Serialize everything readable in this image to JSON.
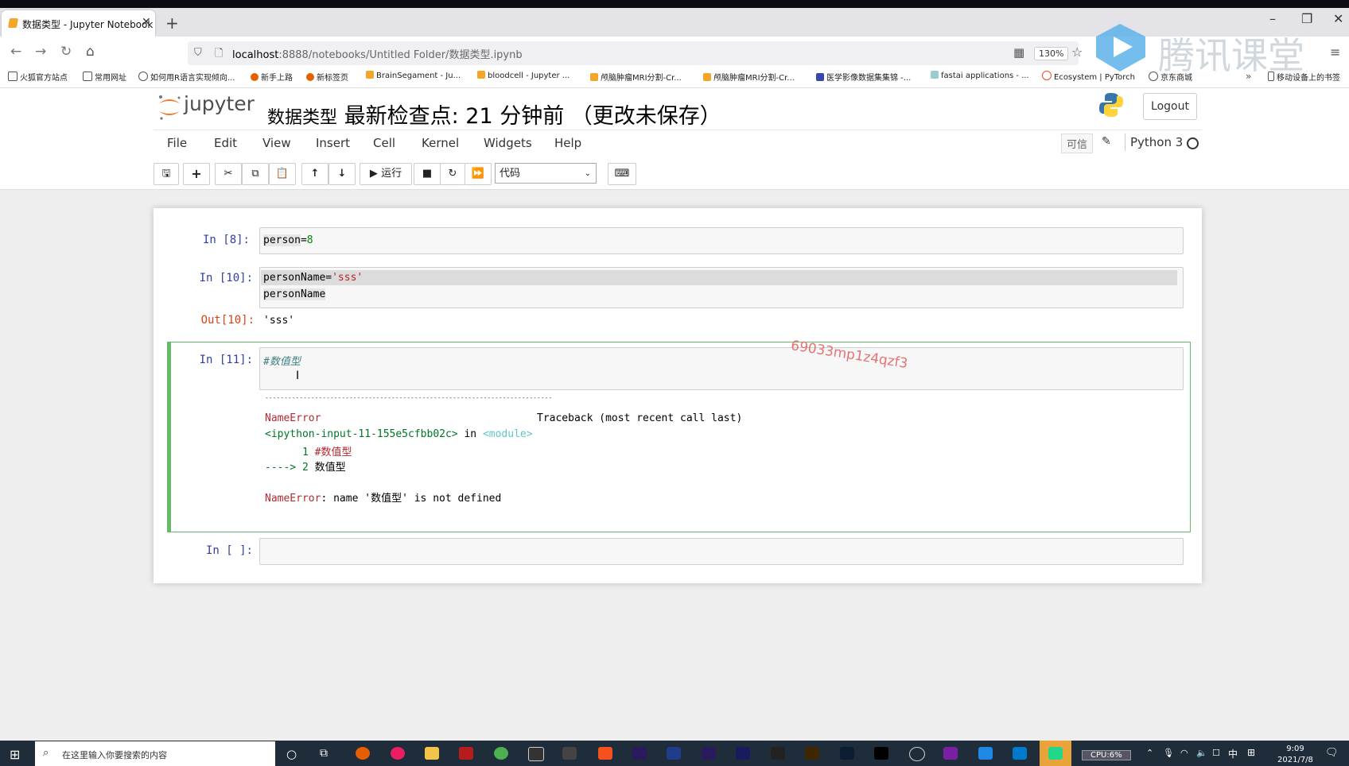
{
  "browser": {
    "tab_title": "数据类型 - Jupyter Notebook",
    "url_host": "localhost",
    "url_rest": ":8888/notebooks/Untitled Folder/数据类型.ipynb",
    "zoom": "130%",
    "bookmarks": [
      "火狐官方站点",
      "常用网址",
      "如何用R语言实现倾向...",
      "新手上路",
      "新标签页",
      "BrainSegament - Ju...",
      "bloodcell - Jupyter ...",
      "颅脑肿瘤MRI分割-Cr...",
      "颅脑肿瘤MRI分割-Cr...",
      "医学影像数据集集锦 -...",
      "fastai applications - ...",
      "Ecosystem | PyTorch",
      "京东商城"
    ],
    "mobile_bookmarks": "移动设备上的书签"
  },
  "overlay": {
    "brand": "腾讯课堂",
    "watermark": "69033mp1z4qzf3"
  },
  "jupyter": {
    "logo_text": "jupyter",
    "notebook_name": "数据类型",
    "checkpoint": "最新检查点: 21 分钟前 （更改未保存）",
    "logout": "Logout",
    "menu": [
      "File",
      "Edit",
      "View",
      "Insert",
      "Cell",
      "Kernel",
      "Widgets",
      "Help"
    ],
    "trusted": "可信",
    "kernel": "Python 3",
    "run_label": "运行",
    "cell_type": "代码"
  },
  "cells": {
    "c1_prompt": "In  [8]:",
    "c1_code_a": "person",
    "c1_code_b": "=",
    "c1_code_c": "8",
    "c2_prompt": "In  [10]:",
    "c2_line1_a": "personName",
    "c2_line1_b": "=",
    "c2_line1_c": "'sss'",
    "c2_line2": "personName",
    "c2_out_prompt": "Out[10]:",
    "c2_out": "'sss'",
    "c3_prompt": "In  [11]:",
    "c3_code": "#数值型",
    "err_rule": "---------------------------------------------------------------------------",
    "err_name": "NameError",
    "err_traceback": "Traceback (most recent call last)",
    "err_input": "<ipython-input-11-155e5cfbb02c>",
    "err_in": " in ",
    "err_module": "<module>",
    "err_line1_no": "      1 ",
    "err_line1_code": "#数值型",
    "err_arrow": "----> 2 ",
    "err_line2_code": "数值型",
    "err_final_name": "NameError",
    "err_final_msg": ": name '数值型' is not defined",
    "c4_prompt": "In  [ ]:"
  },
  "taskbar": {
    "search_placeholder": "在这里输入你要搜索的内容",
    "cpu": "CPU:6%",
    "ime": "中",
    "time": "9:09",
    "date": "2021/7/8"
  }
}
